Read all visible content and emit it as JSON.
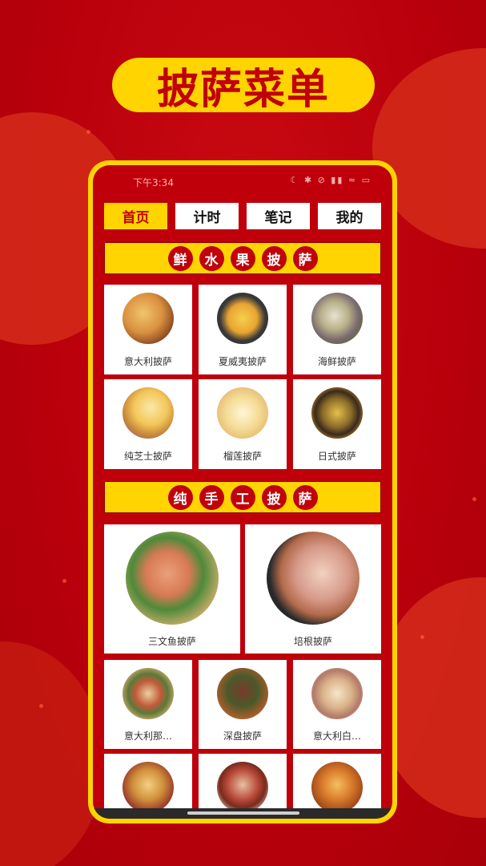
{
  "banner": {
    "title": "披萨菜单"
  },
  "status_bar": {
    "time": "下午3:34",
    "icons": "☾ ✱ ⊘ ▮▮ ≈ ▭"
  },
  "tabs": [
    {
      "label": "首页",
      "active": true
    },
    {
      "label": "计时",
      "active": false
    },
    {
      "label": "笔记",
      "active": false
    },
    {
      "label": "我的",
      "active": false
    }
  ],
  "section_fruit": {
    "chars": [
      "鲜",
      "水",
      "果",
      "披",
      "萨"
    ]
  },
  "section_handmade": {
    "chars": [
      "纯",
      "手",
      "工",
      "披",
      "萨"
    ]
  },
  "fruit_pizzas": [
    {
      "name": "意大利披萨"
    },
    {
      "name": "夏威夷披萨"
    },
    {
      "name": "海鲜披萨"
    },
    {
      "name": "纯芝士披萨"
    },
    {
      "name": "榴莲披萨"
    },
    {
      "name": "日式披萨"
    }
  ],
  "handmade_large": [
    {
      "name": "三文鱼披萨"
    },
    {
      "name": "培根披萨"
    }
  ],
  "handmade_small": [
    {
      "name": "意大利那…"
    },
    {
      "name": "深盘披萨"
    },
    {
      "name": "意大利白…"
    },
    {
      "name": ""
    },
    {
      "name": ""
    },
    {
      "name": ""
    }
  ],
  "colors": {
    "brand_red": "#c0000a",
    "brand_yellow": "#ffd400"
  }
}
